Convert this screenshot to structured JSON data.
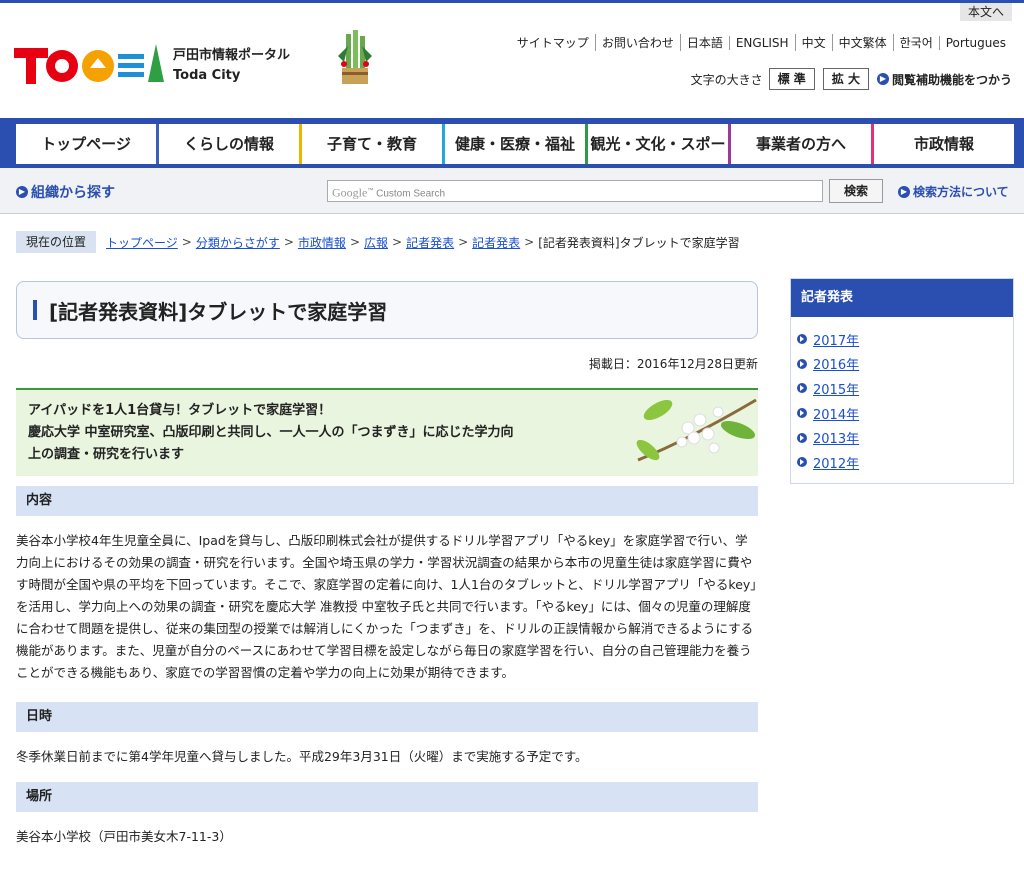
{
  "header": {
    "skip_label": "本文へ",
    "site_title": "戸田市情報ポータル",
    "site_subtitle": "Toda City",
    "links": [
      "サイトマップ",
      "お問い合わせ",
      "日本語",
      "ENGLISH",
      "中文",
      "中文繁体",
      "한국어",
      "Portugues"
    ],
    "font_size_label": "文字の大きさ",
    "font_standard": "標 準",
    "font_large": "拡 大",
    "assist_label": "閲覧補助機能をつかう"
  },
  "nav": {
    "items": [
      {
        "label": "トップページ",
        "color": "#3b5fb7"
      },
      {
        "label": "くらしの情報",
        "color": "#f0b400"
      },
      {
        "label": "子育て・教育",
        "color": "#25a7d8"
      },
      {
        "label": "健康・医療・福祉",
        "color": "#2e9a45"
      },
      {
        "label": "観光・文化・スポーツ",
        "color": "#9b3a9b"
      },
      {
        "label": "事業者の方へ",
        "color": "#e0317a"
      },
      {
        "label": "市政情報",
        "color": "#e8732a"
      }
    ]
  },
  "search": {
    "org_label": "組織から探す",
    "placeholder": "Custom Search",
    "button": "検索",
    "help": "検索方法について"
  },
  "breadcrumb": {
    "here_label": "現在の位置",
    "links": [
      "トップページ",
      "分類からさがす",
      "市政情報",
      "広報",
      "記者発表",
      "記者発表"
    ],
    "current": "[記者発表資料]タブレットで家庭学習"
  },
  "article": {
    "title": "[記者発表資料]タブレットで家庭学習",
    "updated": "掲載日：2016年12月28日更新",
    "lead_line1": "アイパッドを1人1台貸与！タブレットで家庭学習！",
    "lead_line2": "慶応大学 中室研究室、凸版印刷と共同し、一人一人の「つまずき」に応じた学力向",
    "lead_line3": "上の調査・研究を行います",
    "sections": [
      {
        "heading": "内容",
        "body": "美谷本小学校4年生児童全員に、Ipadを貸与し、凸版印刷株式会社が提供するドリル学習アプリ「やるkey」を家庭学習で行い、学力向上におけるその効果の調査・研究を行います。全国や埼玉県の学力・学習状況調査の結果から本市の児童生徒は家庭学習に費やす時間が全国や県の平均を下回っています。そこで、家庭学習の定着に向け、1人1台のタブレットと、ドリル学習アプリ「やるkey」を活用し、学力向上への効果の調査・研究を慶応大学 准教授 中室牧子氏と共同で行います。「やるkey」には、個々の児童の理解度に合わせて問題を提供し、従来の集団型の授業では解消しにくかった「つまずき」を、ドリルの正誤情報から解消できるようにする機能があります。また、児童が自分のペースにあわせて学習目標を設定しながら毎日の家庭学習を行い、自分の自己管理能力を養うことができる機能もあり、家庭での学習習慣の定着や学力の向上に効果が期待できます。"
      },
      {
        "heading": "日時",
        "body": "冬季休業日前までに第4学年児童へ貸与しました。平成29年3月31日（火曜）まで実施する予定です。"
      },
      {
        "heading": "場所",
        "body": "美谷本小学校（戸田市美女木7-11-3）"
      }
    ]
  },
  "sidebar": {
    "heading": "記者発表",
    "years": [
      "2017年",
      "2016年",
      "2015年",
      "2014年",
      "2013年",
      "2012年"
    ]
  }
}
